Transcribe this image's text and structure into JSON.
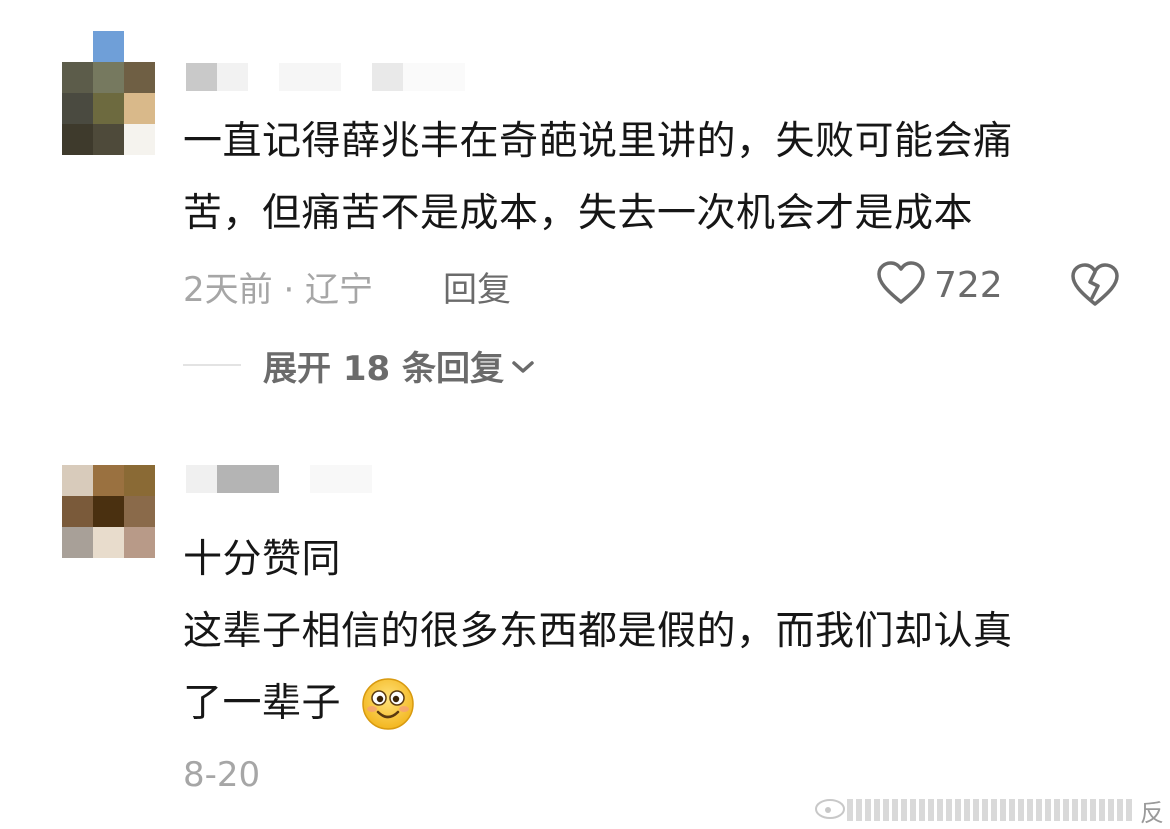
{
  "comments": [
    {
      "text_lines": [
        "一直记得薛兆丰在奇葩说里讲的，失败可能会痛",
        "苦，但痛苦不是成本，失去一次机会才是成本"
      ],
      "time_location": "2天前 · 辽宁",
      "reply_label": "回复",
      "like_count": "722",
      "expand_label": "展开 18 条回复"
    },
    {
      "text_lines": [
        "十分赞同",
        "这辈子相信的很多东西都是假的，而我们却认真",
        "了一辈子"
      ],
      "time_location": "8-20"
    }
  ],
  "watermark": {
    "end_text": "反"
  },
  "icons": {
    "like": "heart-outline-icon",
    "dislike": "broken-heart-icon",
    "chevron": "chevron-down-icon",
    "emoji": "smiling-face-emoji"
  }
}
